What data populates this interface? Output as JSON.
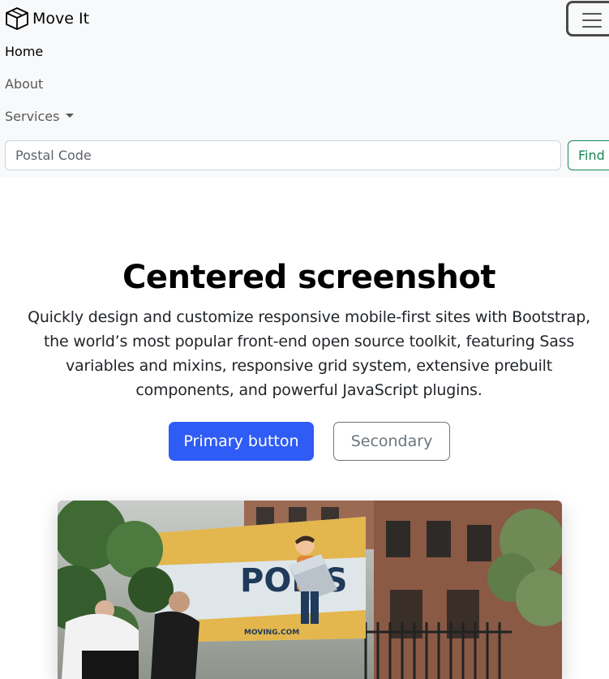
{
  "brand": {
    "name": "Move It",
    "icon": "box-icon"
  },
  "nav": {
    "toggler_icon": "hamburger-menu-icon",
    "items": [
      {
        "label": "Home",
        "active": true
      },
      {
        "label": "About",
        "active": false
      },
      {
        "label": "Services",
        "active": false,
        "dropdown": true
      }
    ]
  },
  "search": {
    "placeholder": "Postal Code",
    "value": "",
    "button_label": "Find"
  },
  "hero": {
    "title": "Centered screenshot",
    "lead": "Quickly design and customize responsive mobile-first sites with Bootstrap, the world’s most popular front-end open source toolkit, featuring Sass variables and mixins, responsive grid system, extensive prebuilt components, and powerful JavaScript plugins.",
    "primary_label": "Primary button",
    "secondary_label": "Secondary",
    "image_truck_text": "POLIS",
    "image_truck_url_fragment": "MOVING.COM"
  },
  "colors": {
    "navbar_bg": "#f8f9fa",
    "primary": "#2f5cf5",
    "success": "#198754",
    "secondary": "#6c757d"
  }
}
